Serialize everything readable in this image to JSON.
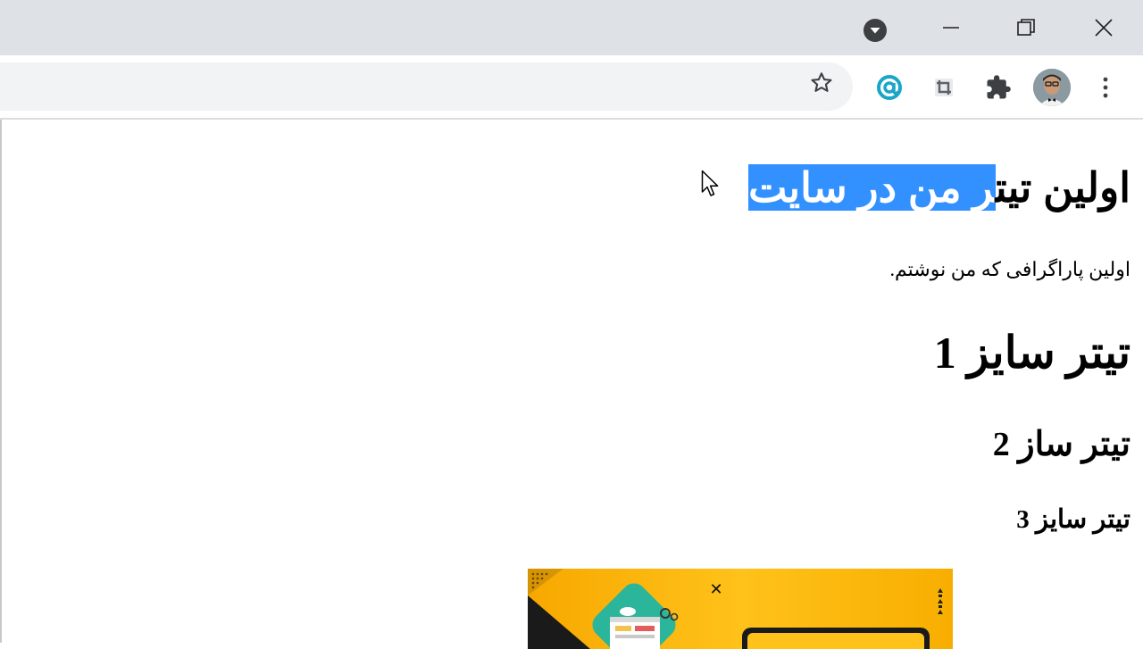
{
  "window": {
    "controls": {
      "tab_search": "tab-search-icon",
      "minimize": "minimize-icon",
      "restore": "restore-icon",
      "close": "close-icon"
    }
  },
  "toolbar": {
    "icons": [
      "star-icon",
      "extension-at-icon",
      "crop-icon",
      "puzzle-icon",
      "avatar",
      "kebab-menu-icon"
    ]
  },
  "page": {
    "title_unselected": "اولین تیت",
    "title_selected": "ر من در سایت",
    "paragraph": "اولین پاراگرافی که من نوشتم.",
    "heading1": "تیتر سایز 1",
    "heading2": "تیتر ساز 2",
    "heading3": "تیتر سایز 3"
  },
  "ad": {
    "close_label": "✕"
  },
  "colors": {
    "selection": "#3390ff",
    "titlebar": "#dee1e6",
    "omnibox": "#f1f3f4",
    "ad_yellow": "#ffc21a"
  }
}
